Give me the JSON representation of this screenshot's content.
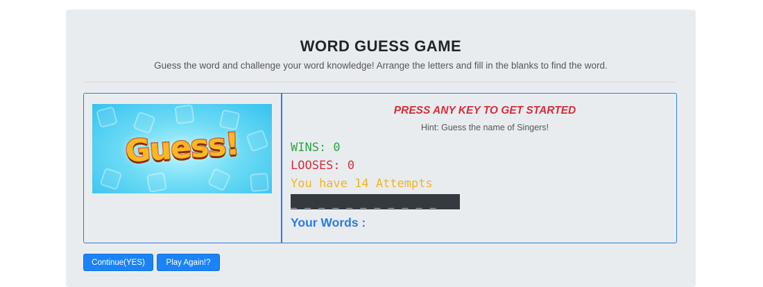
{
  "header": {
    "title": "WORD GUESS GAME",
    "subtitle": "Guess the word and challenge your word knowledge! Arrange the letters and fill in the blanks to find the word."
  },
  "image": {
    "logo_text": "Guess!"
  },
  "game": {
    "prompt": "PRESS ANY KEY TO GET STARTED",
    "hint": "Hint: Guess the name of Singers!",
    "wins": "WINS: 0",
    "looses": "LOOSES: 0",
    "attempts": "You have 14 Attempts",
    "blanks": "_ _ _ _ _ _ _ _ _ _ _",
    "your_words": "Your Words :"
  },
  "buttons": {
    "continue": "Continue(YES)",
    "play_again": "Play Again!?"
  },
  "colors": {
    "accent": "#2a7de1",
    "wins": "#28a745",
    "looses": "#d32f3a",
    "attempts": "#f0b41e",
    "button": "#1a84f7"
  }
}
